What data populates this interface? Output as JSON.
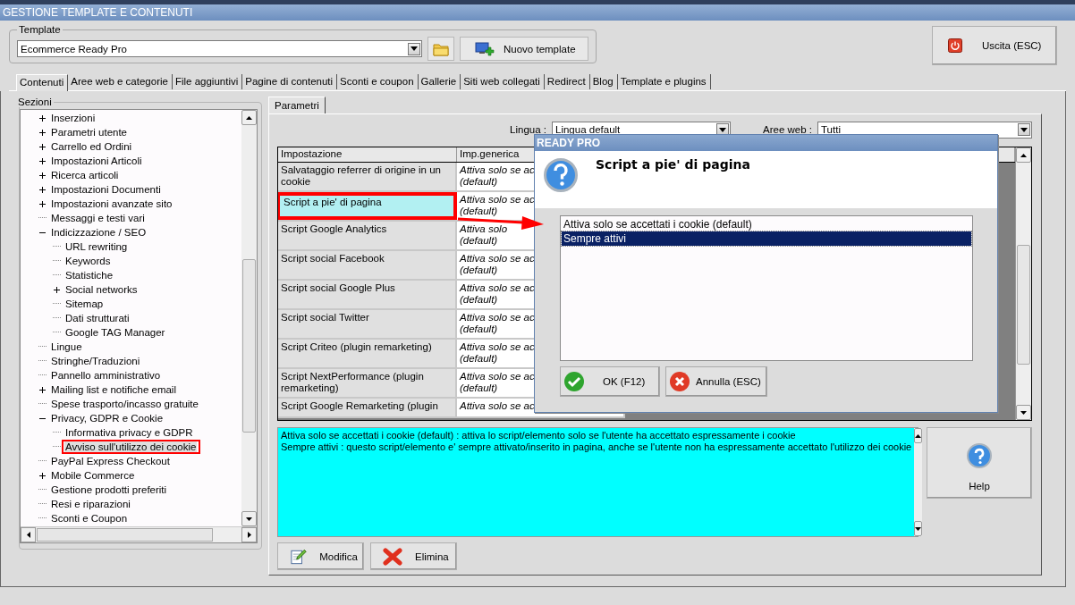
{
  "window": {
    "title": "GESTIONE TEMPLATE E CONTENUTI"
  },
  "template": {
    "label": "Template",
    "value": "Ecommerce Ready Pro",
    "new_button": "Nuovo template"
  },
  "exit_button": "Uscita (ESC)",
  "tabs": [
    {
      "label": "Contenuti",
      "selected": true
    },
    {
      "label": "Aree web e categorie",
      "selected": false
    },
    {
      "label": "File aggiuntivi",
      "selected": false
    },
    {
      "label": "Pagine di contenuti",
      "selected": false
    },
    {
      "label": "Sconti e coupon",
      "selected": false
    },
    {
      "label": "Gallerie",
      "selected": false
    },
    {
      "label": "Siti web collegati",
      "selected": false
    },
    {
      "label": "Redirect",
      "selected": false
    },
    {
      "label": "Blog",
      "selected": false
    },
    {
      "label": "Template e plugins",
      "selected": false
    }
  ],
  "sections": {
    "label": "Sezioni",
    "tree": [
      {
        "label": "Inserzioni",
        "kind": "group",
        "expanded": false,
        "selected": false
      },
      {
        "label": "Parametri utente",
        "kind": "group",
        "expanded": false,
        "selected": false
      },
      {
        "label": "Carrello ed Ordini",
        "kind": "group",
        "expanded": false,
        "selected": false
      },
      {
        "label": "Impostazioni Articoli",
        "kind": "group",
        "expanded": false,
        "selected": false
      },
      {
        "label": "Ricerca articoli",
        "kind": "group",
        "expanded": false,
        "selected": false
      },
      {
        "label": "Impostazioni Documenti",
        "kind": "group",
        "expanded": false,
        "selected": false
      },
      {
        "label": "Impostazioni avanzate sito",
        "kind": "group",
        "expanded": false,
        "selected": false
      },
      {
        "label": "Messaggi e testi vari",
        "kind": "leaf",
        "selected": false
      },
      {
        "label": "Indicizzazione / SEO",
        "kind": "group",
        "expanded": true,
        "selected": false,
        "children": [
          {
            "label": "URL rewriting",
            "kind": "leaf",
            "selected": false
          },
          {
            "label": "Keywords",
            "kind": "leaf",
            "selected": false
          },
          {
            "label": "Statistiche",
            "kind": "leaf",
            "selected": false
          },
          {
            "label": "Social networks",
            "kind": "group",
            "expanded": false,
            "selected": false
          },
          {
            "label": "Sitemap",
            "kind": "leaf",
            "selected": false
          },
          {
            "label": "Dati strutturati",
            "kind": "leaf",
            "selected": false
          },
          {
            "label": "Google TAG Manager",
            "kind": "leaf",
            "selected": false
          }
        ]
      },
      {
        "label": "Lingue",
        "kind": "leaf",
        "selected": false
      },
      {
        "label": "Stringhe/Traduzioni",
        "kind": "leaf",
        "selected": false
      },
      {
        "label": "Pannello amministrativo",
        "kind": "leaf",
        "selected": false
      },
      {
        "label": "Mailing list e notifiche email",
        "kind": "group",
        "expanded": false,
        "selected": false
      },
      {
        "label": "Spese trasporto/incasso gratuite",
        "kind": "leaf",
        "selected": false
      },
      {
        "label": "Privacy, GDPR e Cookie",
        "kind": "group",
        "expanded": true,
        "selected": false,
        "children": [
          {
            "label": "Informativa privacy e GDPR",
            "kind": "leaf",
            "selected": false
          },
          {
            "label": "Avviso sull'utilizzo dei cookie",
            "kind": "leaf",
            "selected": true
          }
        ]
      },
      {
        "label": "PayPal Express Checkout",
        "kind": "leaf",
        "selected": false
      },
      {
        "label": "Mobile Commerce",
        "kind": "group",
        "expanded": false,
        "selected": false
      },
      {
        "label": "Gestione prodotti preferiti",
        "kind": "leaf",
        "selected": false
      },
      {
        "label": "Resi e riparazioni",
        "kind": "leaf",
        "selected": false
      },
      {
        "label": "Sconti e Coupon",
        "kind": "leaf",
        "selected": false
      }
    ]
  },
  "params_tab": {
    "label": "Parametri",
    "selected": true
  },
  "filters": [
    {
      "label": "Lingua :",
      "value": "Lingua default"
    },
    {
      "label": "Aree web :",
      "value": "Tutti"
    }
  ],
  "table": {
    "columns": [
      "Impostazione",
      "Imp.generica"
    ],
    "rows": [
      {
        "setting": "Salvataggio referrer di origine in un cookie",
        "generic": [
          "Attiva solo se ac",
          "(default)"
        ],
        "selected": false
      },
      {
        "setting": "Script a pie' di pagina",
        "generic": [
          "Attiva solo se ac",
          "(default)"
        ],
        "selected": true
      },
      {
        "setting": "Script Google Analytics",
        "generic": [
          "Attiva solo",
          "(default)"
        ],
        "selected": false
      },
      {
        "setting": "Script social Facebook",
        "generic": [
          "Attiva solo se ac",
          "(default)"
        ],
        "selected": false
      },
      {
        "setting": "Script social Google Plus",
        "generic": [
          "Attiva solo se ac",
          "(default)"
        ],
        "selected": false
      },
      {
        "setting": "Script social Twitter",
        "generic": [
          "Attiva solo se ac",
          "(default)"
        ],
        "selected": false
      },
      {
        "setting": "Script Criteo (plugin remarketing)",
        "generic": [
          "Attiva solo se ac",
          "(default)"
        ],
        "selected": false
      },
      {
        "setting": "Script NextPerformance (plugin remarketing)",
        "generic": [
          "Attiva solo se ac",
          "(default)"
        ],
        "selected": false
      },
      {
        "setting": "Script Google Remarketing (plugin",
        "generic": [
          "Attiva solo se ac"
        ],
        "selected": false
      }
    ]
  },
  "description": [
    "Attiva solo se accettati i cookie (default) : attiva lo script/elemento solo se l'utente ha accettato espressamente i cookie",
    "Sempre attivi : questo script/elemento e' sempre attivato/inserito in pagina, anche se l'utente non ha espressamente accettato l'utilizzo dei cookie"
  ],
  "help_button": "Help",
  "actions": [
    {
      "label": "Modifica",
      "kind": "edit"
    },
    {
      "label": "Elimina",
      "kind": "delete"
    }
  ],
  "dialog": {
    "title": "READY PRO",
    "heading": "Script a pie' di pagina",
    "options": [
      {
        "label": "Attiva solo se accettati i cookie (default)",
        "selected": false
      },
      {
        "label": "Sempre attivi",
        "selected": true
      }
    ],
    "buttons": [
      {
        "label": "OK (F12)",
        "kind": "ok"
      },
      {
        "label": "Annulla (ESC)",
        "kind": "cancel"
      }
    ]
  }
}
